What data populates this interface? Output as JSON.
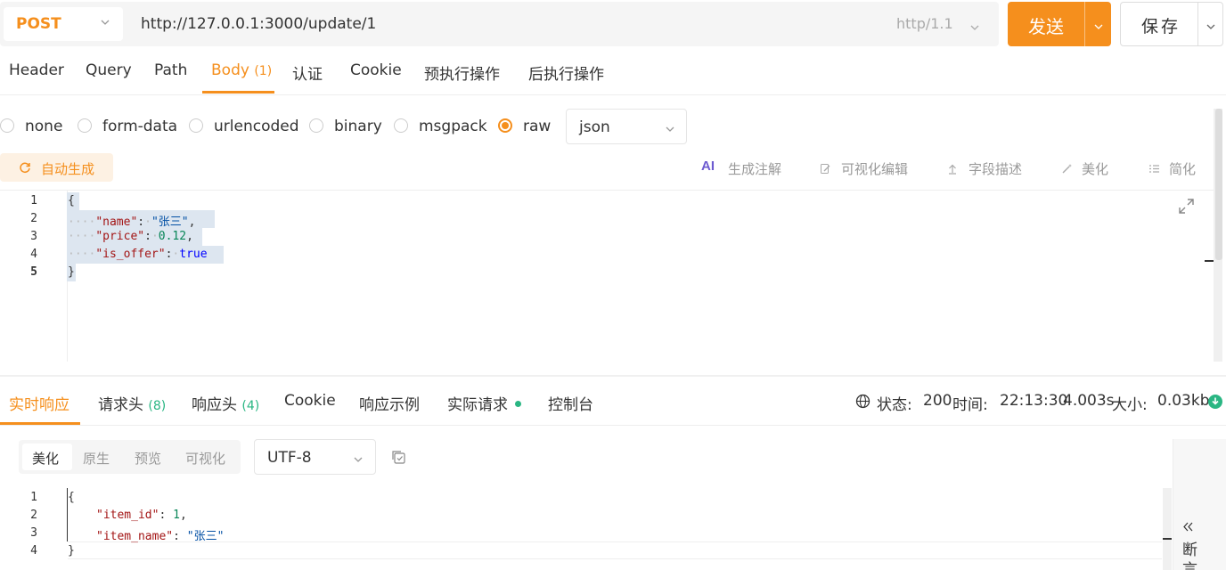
{
  "request": {
    "method": "POST",
    "url": "http://127.0.0.1:3000/update/1",
    "protocol": "http/1.1",
    "send_label": "发送",
    "save_label": "保存"
  },
  "tabs": [
    {
      "label": "Header"
    },
    {
      "label": "Query"
    },
    {
      "label": "Path"
    },
    {
      "label": "Body",
      "count": "(1)"
    },
    {
      "label": "认证"
    },
    {
      "label": "Cookie"
    },
    {
      "label": "预执行操作"
    },
    {
      "label": "后执行操作"
    }
  ],
  "body_types": [
    "none",
    "form-data",
    "urlencoded",
    "binary",
    "msgpack",
    "raw"
  ],
  "raw_format": "json",
  "toolbar": {
    "auto_generate": "自动生成",
    "ai_comment": "生成注解",
    "visual_edit": "可视化编辑",
    "field_desc": "字段描述",
    "beautify": "美化",
    "simplify": "简化"
  },
  "request_body": {
    "line_numbers": [
      "1",
      "2",
      "3",
      "4",
      "5"
    ],
    "open_brace": "{",
    "close_brace": "}",
    "name_key": "\"name\"",
    "name_val": "\"张三\"",
    "price_key": "\"price\"",
    "price_val": "0.12",
    "offer_key": "\"is_offer\"",
    "offer_val": "true"
  },
  "response_tabs": [
    {
      "label": "实时响应"
    },
    {
      "label": "请求头",
      "count": "(8)"
    },
    {
      "label": "响应头",
      "count": "(4)"
    },
    {
      "label": "Cookie"
    },
    {
      "label": "响应示例"
    },
    {
      "label": "实际请求"
    },
    {
      "label": "控制台"
    }
  ],
  "status": {
    "status_label": "状态:",
    "status_code": "200",
    "time_label": "时间:",
    "time_value": "22:13:30",
    "duration": "4.003s",
    "size_label": "大小:",
    "size_value": "0.03kb"
  },
  "view_modes": [
    "美化",
    "原生",
    "预览",
    "可视化"
  ],
  "encoding": "UTF-8",
  "response_body": {
    "line_numbers": [
      "1",
      "2",
      "3",
      "4"
    ],
    "open_brace": "{",
    "close_brace": "}",
    "id_key": "\"item_id\"",
    "id_val": "1",
    "name_key": "\"item_name\"",
    "name_val": "\"张三\""
  },
  "side_panel": {
    "label": "断言"
  },
  "colors": {
    "accent": "#f58f1d",
    "success": "#2ab683"
  }
}
